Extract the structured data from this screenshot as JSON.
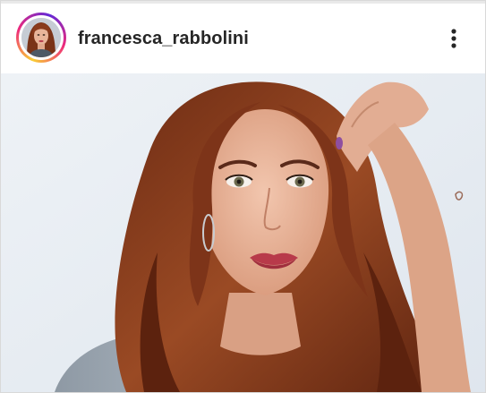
{
  "post": {
    "header": {
      "username": "francesca_rabbolini",
      "avatar_icon": "profile-photo",
      "more_icon": "more-vertical-icon"
    },
    "photo": {
      "subject": "portrait photo"
    }
  },
  "colors": {
    "story_ring": [
      "#f9ce34",
      "#ee2a7b",
      "#6228d7"
    ],
    "username_text": "#262626",
    "hair": "#8a3b1c",
    "background": "#e6ecf2"
  }
}
